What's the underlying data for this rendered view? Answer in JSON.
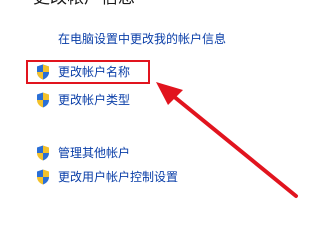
{
  "page": {
    "title": "更改帐户信息",
    "pc_settings_link": "在电脑设置中更改我的帐户信息"
  },
  "tasks": [
    {
      "label": "更改帐户名称",
      "icon": "uac-shield-icon"
    },
    {
      "label": "更改帐户类型",
      "icon": "uac-shield-icon"
    },
    {
      "label": "管理其他帐户",
      "icon": "uac-shield-icon"
    },
    {
      "label": "更改用户帐户控制设置",
      "icon": "uac-shield-icon"
    }
  ],
  "colors": {
    "link": "#0a3ea8",
    "highlight": "#e1141e",
    "shield_blue": "#2a6fd6",
    "shield_yellow": "#f3c12b"
  }
}
